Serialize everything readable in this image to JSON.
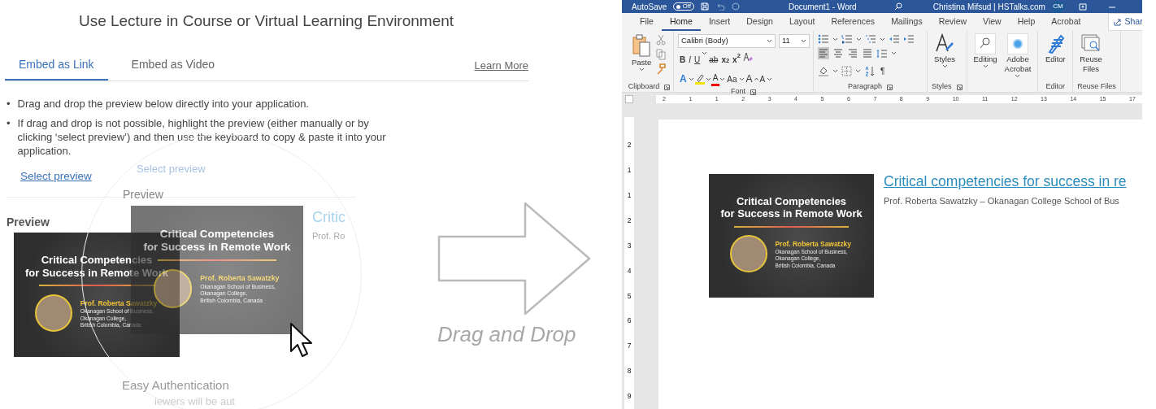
{
  "lecture_panel": {
    "title": "Use Lecture in Course or Virtual Learning Environment",
    "tabs": [
      {
        "label": "Embed as Link",
        "selected": true
      },
      {
        "label": "Embed as Video",
        "selected": false
      }
    ],
    "learn_more": "Learn More",
    "instructions": [
      {
        "bullet": "•",
        "text": "Drag and drop the preview below directly into your application."
      },
      {
        "bullet": "•",
        "text": "If drag and drop is not possible, highlight the preview (either manually or by clicking ‘select preview’) and then use the keyboard to copy & paste it into your application."
      }
    ],
    "select_preview": "Select preview",
    "preview_label": "Preview",
    "preview_thumbnail": {
      "title_lines": [
        "Critical Competencies",
        "for Success in Remote Work"
      ],
      "speaker": "Prof. Roberta Sawatzky",
      "affiliation_lines": [
        "Okanagan School of Business,",
        "Okanagan College,",
        "British Colombia, Canada"
      ]
    },
    "dragged_thumbnail": {
      "title_lines": [
        "Critical Competencies",
        "for Success in Remote Work"
      ],
      "speaker": "Prof. Roberta Sawatzky",
      "affiliation_lines": [
        "Okanagan School of Business,",
        "Okanagan College,",
        "British Colombia, Canada"
      ]
    },
    "magnifier": {
      "select_preview": "Select preview",
      "preview_label": "Preview",
      "link_title": "Critic",
      "byline": "Prof. Ro",
      "section_title": "Easy Authentication",
      "section_text": "iewers will be aut"
    }
  },
  "drag_hint": {
    "label": "Drag and Drop"
  },
  "word_window": {
    "autosave": {
      "label": "AutoSave",
      "state_text": "Off",
      "on": false
    },
    "title": "Document1 - Word",
    "account": "Christina Mifsud | HSTalks.com",
    "avatar_initials": "CM",
    "tabs": [
      {
        "label": "File",
        "selected": false
      },
      {
        "label": "Home",
        "selected": true
      },
      {
        "label": "Insert",
        "selected": false
      },
      {
        "label": "Design",
        "selected": false
      },
      {
        "label": "Layout",
        "selected": false
      },
      {
        "label": "References",
        "selected": false
      },
      {
        "label": "Mailings",
        "selected": false
      },
      {
        "label": "Review",
        "selected": false
      },
      {
        "label": "View",
        "selected": false
      },
      {
        "label": "Help",
        "selected": false
      },
      {
        "label": "Acrobat",
        "selected": false
      }
    ],
    "share": "Shar",
    "clipboard": {
      "paste": "Paste",
      "group_label": "Clipboard",
      "launcher": true
    },
    "font": {
      "name": "Calibri (Body)",
      "size": "11",
      "group_label": "Font",
      "launcher": true,
      "format_buttons": [
        {
          "kind": "bold",
          "label": "B"
        },
        {
          "kind": "italic",
          "label": "I"
        },
        {
          "kind": "underline",
          "label": "U"
        },
        {
          "kind": "strike",
          "label": "ab"
        },
        {
          "kind": "script",
          "label": "x$_{2}$"
        },
        {
          "kind": "script",
          "label": "x$^{2}$"
        }
      ],
      "effect_buttons": [
        {
          "kind": "effects",
          "label": "A"
        },
        {
          "kind": "highlight"
        },
        {
          "kind": "color",
          "label": "A"
        },
        {
          "kind": "case",
          "label": "Aa"
        },
        {
          "kind": "grow",
          "label": "A"
        },
        {
          "kind": "shrink",
          "label": "A"
        }
      ]
    },
    "paragraph": {
      "group_label": "Paragraph",
      "launcher": true,
      "pilcrow": "¶",
      "alignments": [
        {
          "kind": "left",
          "selected": true
        },
        {
          "kind": "center",
          "selected": false
        },
        {
          "kind": "right",
          "selected": false
        },
        {
          "kind": "justify",
          "selected": false
        }
      ]
    },
    "big_groups": [
      {
        "label": "Styles",
        "launcher": true,
        "buttons": [
          {
            "kind": "styles",
            "label": "Styles",
            "dropdown": true
          }
        ]
      },
      {
        "buttons": [
          {
            "kind": "editing",
            "label": "Editing",
            "dropdown": true
          },
          {
            "kind": "acrobat",
            "label": "Adobe Acrobat",
            "dropdown": true
          }
        ]
      },
      {
        "label": "Editor",
        "launcher": false,
        "buttons": [
          {
            "kind": "editor",
            "label": "Editor",
            "dropdown": false
          }
        ]
      },
      {
        "label": "Reuse Files",
        "launcher": false,
        "buttons": [
          {
            "kind": "reuse",
            "label": "Reuse Files",
            "dropdown": false
          }
        ]
      }
    ],
    "ruler_numbers": [
      "2",
      "1",
      "1",
      "2",
      "3",
      "4",
      "5",
      "6",
      "7",
      "8",
      "9",
      "10",
      "11",
      "12",
      "13",
      "14",
      "15",
      "17"
    ],
    "vertical_ruler_numbers": [
      "2",
      "1",
      "1",
      "2",
      "3",
      "4",
      "5",
      "6",
      "7",
      "8",
      "9"
    ],
    "document": {
      "thumbnail": {
        "title_lines": [
          "Critical Competencies",
          "for Success in Remote Work"
        ],
        "speaker": "Prof. Roberta Sawatzky",
        "affiliation_lines": [
          "Okanagan School of Business,",
          "Okanagan College,",
          "British Colombia, Canada"
        ]
      },
      "link_title": "Critical competencies for success in re",
      "byline": "Prof. Roberta Sawatzky – Okanagan College School of Bus"
    }
  }
}
